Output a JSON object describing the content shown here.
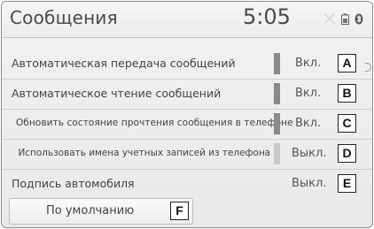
{
  "header": {
    "title": "Сообщения",
    "clock": "5:05",
    "icons": [
      "signal-icon",
      "phone-battery-icon",
      "bluetooth-icon"
    ]
  },
  "settings": [
    {
      "label": "Автоматическая передача сообщений",
      "value": "Вкл.",
      "state": "on",
      "callout": "A"
    },
    {
      "label": "Автоматическое чтение сообщений",
      "value": "Вкл.",
      "state": "on",
      "callout": "B"
    },
    {
      "label": "Обновить состояние прочтения сообщения в телефоне",
      "value": "Вкл.",
      "state": "on",
      "callout": "C"
    },
    {
      "label": "Использовать имена учетных записей из телефона",
      "value": "Выкл.",
      "state": "off",
      "callout": "D"
    },
    {
      "label": "Подпись автомобиля",
      "value": "Выкл.",
      "state": "none",
      "callout": "E"
    }
  ],
  "default_button": {
    "label": "По умолчанию",
    "callout": "F"
  },
  "colors": {
    "toggle_on": "#8a8a8a",
    "toggle_off": "#c8c8c8",
    "background": "#ececec"
  }
}
